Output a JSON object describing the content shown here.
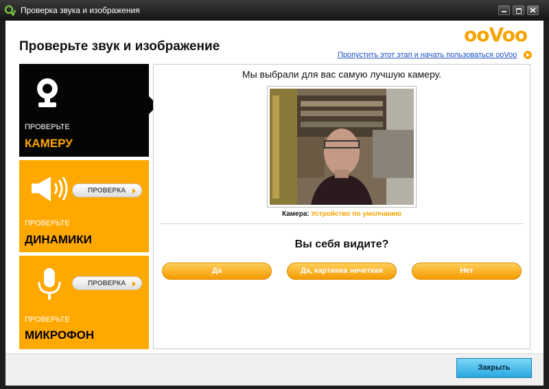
{
  "window": {
    "title": "Проверка звука и изображения",
    "buttons": [
      "minimize",
      "maximize",
      "close"
    ]
  },
  "header": {
    "title": "Проверьте звук и изображение",
    "logo_text": "ooVoo",
    "skip_link": "Пропустить этот этап и начать пользоваться ooVoo"
  },
  "sidebar": {
    "camera": {
      "label_top": "ПРОВЕРЬТЕ",
      "label_big": "КАМЕРУ",
      "icon": "webcam-icon",
      "active": true
    },
    "speakers": {
      "label_top": "ПРОВЕРЬТЕ",
      "label_big": "ДИНАМИКИ",
      "icon": "speaker-icon",
      "button": "ПРОВЕРКА"
    },
    "microphone": {
      "label_top": "ПРОВЕРЬТЕ",
      "label_big": "МИКРОФОН",
      "icon": "microphone-icon",
      "button": "ПРОВЕРКА"
    }
  },
  "main": {
    "headline": "Мы выбрали для вас самую лучшую камеру.",
    "camera_label": "Камера:",
    "camera_value": "Устройство по умолчанию",
    "question": "Вы себя видите?",
    "answers": {
      "yes": "Да",
      "blurry": "Да, картинка нечеткая",
      "no": "Нет"
    }
  },
  "footer": {
    "close": "Закрыть"
  },
  "colors": {
    "accent": "#ffa800",
    "link": "#1a4fc4",
    "close_button": "#2aa8e0"
  }
}
